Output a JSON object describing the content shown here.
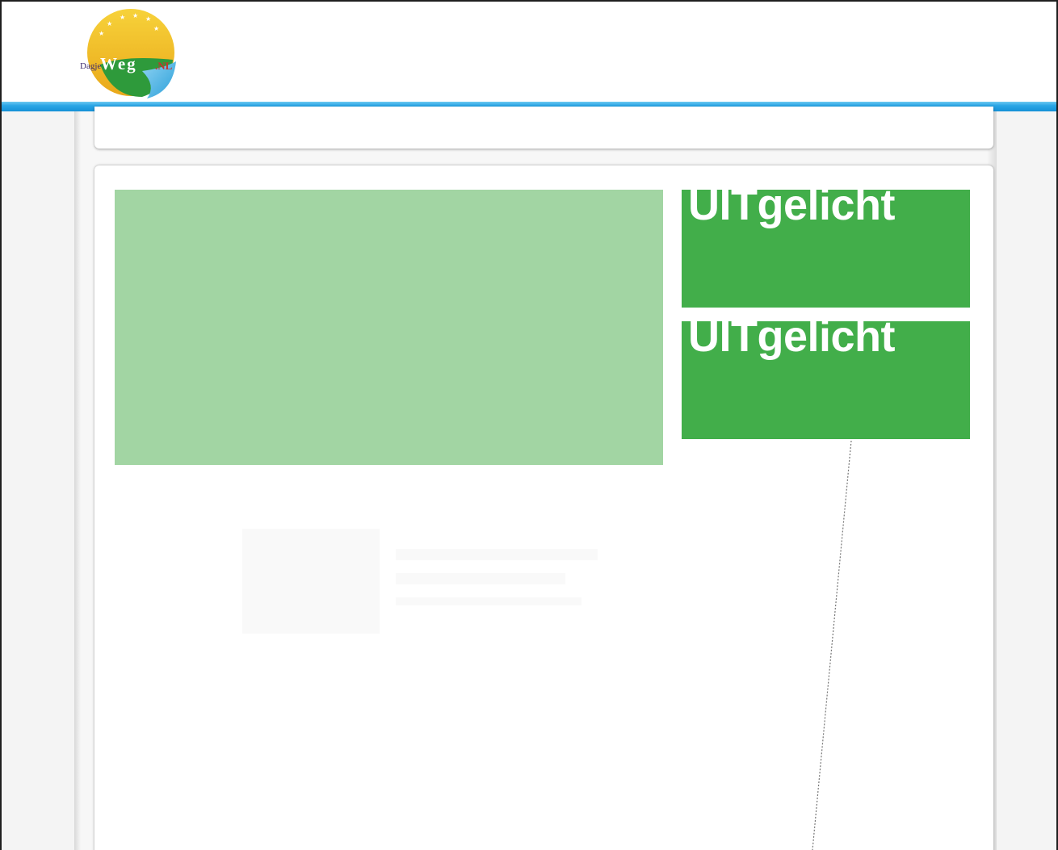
{
  "logo": {
    "prefix": "Dagje",
    "name": "Weg",
    "suffix": ".NL",
    "colors": {
      "sun": "#f2c21a",
      "green": "#2e9a3b",
      "water": "#57b7e6",
      "red": "#c8322b"
    }
  },
  "header": {
    "bar_color": "#1ea0e0"
  },
  "featured": [
    {
      "title": "UITgelicht"
    },
    {
      "title": "UITgelicht"
    }
  ],
  "colors": {
    "hero": "#a2d5a3",
    "promo": "#42ae4a"
  }
}
